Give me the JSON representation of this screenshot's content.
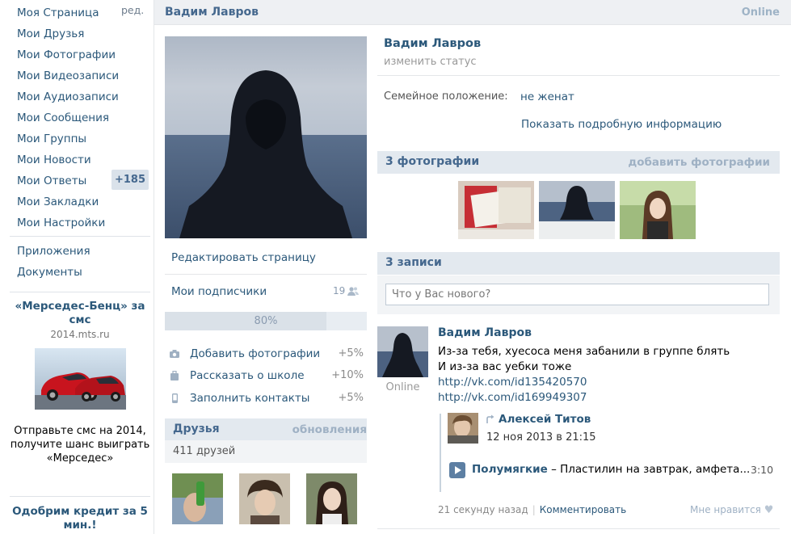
{
  "nav": {
    "items": [
      "Моя Страница",
      "Мои Друзья",
      "Мои Фотографии",
      "Мои Видеозаписи",
      "Мои Аудиозаписи",
      "Мои Сообщения",
      "Мои Группы",
      "Мои Новости",
      "Мои Ответы",
      "Мои Закладки",
      "Мои Настройки"
    ],
    "edit_label": "ред.",
    "answers_badge": "+185",
    "extra": [
      "Приложения",
      "Документы"
    ]
  },
  "ads": [
    {
      "title": "«Мерседес-Бенц» за смс",
      "domain": "2014.mts.ru",
      "text": "Отправьте смс на 2014, получите шанс выиграть «Мерседес»"
    },
    {
      "title": "Одобрим кредит за 5 мин.!"
    }
  ],
  "header": {
    "name": "Вадим Лавров",
    "status": "Online"
  },
  "sidebar": {
    "edit_page": "Редактировать страницу",
    "subscribers": "Мои подписчики",
    "subscribers_count": "19",
    "progress": {
      "value": 0.8,
      "label": "80%"
    },
    "tasks": [
      {
        "label": "Добавить фотографии",
        "pct": "+5%",
        "icon": "camera-icon"
      },
      {
        "label": "Рассказать о школе",
        "pct": "+10%",
        "icon": "bag-icon"
      },
      {
        "label": "Заполнить контакты",
        "pct": "+5%",
        "icon": "phone-icon"
      }
    ],
    "friends": {
      "title": "Друзья",
      "updates": "обновления",
      "count": "411 друзей"
    }
  },
  "profile": {
    "name": "Вадим Лавров",
    "change_status": "изменить статус",
    "family_label": "Семейное положение:",
    "family_value": "не женат",
    "show_more": "Показать подробную информацию"
  },
  "photos": {
    "title": "3 фотографии",
    "add": "добавить фотографии"
  },
  "wall": {
    "title": "3 записи",
    "placeholder": "Что у Вас нового?",
    "post": {
      "author": "Вадим Лавров",
      "online": "Online",
      "lines": [
        "Из-за тебя, хуесоса меня забанили в группе блять",
        "И из-за вас уебки тоже"
      ],
      "links": [
        "http://vk.com/id135420570",
        "http://vk.com/id169949307"
      ],
      "repost_author": "Алексей Титов",
      "repost_date": "12 ноя 2013 в 21:15",
      "audio_artist": "Полумягкие",
      "audio_title": " – Пластилин на завтрак, амфета...",
      "audio_duration": "3:10",
      "time": "21 секунду назад",
      "comment": "Комментировать",
      "like": "Мне нравится"
    }
  }
}
